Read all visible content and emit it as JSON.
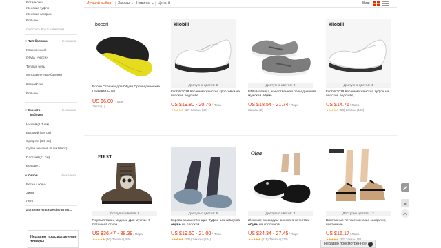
{
  "sidebar": {
    "top_items": [
      "Ботильоны",
      "Женские туфли",
      "Женские сандали",
      "Больше"
    ],
    "more_link": "Смотреть все 5 категорий",
    "shoe_type": {
      "title": "Тип ботинка",
      "reset": "Несколько",
      "items": [
        "Классический",
        "Обувь «челси»",
        "Теплые боты",
        "Мотоциклетные ботинки",
        "Ковбойский",
        "Больше"
      ]
    },
    "heel": {
      "title_line1": "Высота",
      "title_line2": "каблука",
      "reset": "Несколько",
      "items": [
        "Низкий (1-3 см)",
        "Высокий (5-8 см)",
        "Средняя (3-5 см)",
        "Супер высокий (8 см вверх)",
        "Плоский (≤1 см)",
        "Больше"
      ]
    },
    "season": {
      "title": "Сезон",
      "reset": "Несколько",
      "items": [
        "Весна / осень",
        "Зима",
        "Лето"
      ]
    },
    "extra_filters": "Дополнительные фильтры...",
    "recent_title": "Недавно просмотренные товары"
  },
  "toolbar": {
    "best_match": "Лучший выбор",
    "orders": "Заказы",
    "newest": "Новинки",
    "price": "Цена",
    "view_label": "Вид:"
  },
  "products": [
    {
      "brand": "bocori",
      "colors": "",
      "title": "Bocori Стельки для Обуви Ортопедические Подушки Спорт",
      "bold": "",
      "title_rest": "",
      "price": "US $6.00",
      "unit": "/ Пара",
      "rating": "",
      "orders": "Заказ (1)"
    },
    {
      "brand": "kilobili",
      "colors": "Доступно цветов: 2",
      "title": "Kilobili/2018 весенние женские кроссовки на плоской подошве",
      "bold": "",
      "title_rest": "",
      "price": "US $19.80 - 20.76",
      "unit": "/ Пара",
      "rating": "(17)",
      "orders": "Заказы (48)"
    },
    {
      "brand": "",
      "colors": "Доступно цветов: 3",
      "title": "UNN/Новинка, качественная повседневная мужская ",
      "bold": "обувь",
      "title_rest": "",
      "price": "US $18.54 - 21.74",
      "unit": "/ Пара",
      "rating": "",
      "orders": "Заказы (2)"
    },
    {
      "brand": "kilobili",
      "colors": "Доступно цветов: 4",
      "title": "Kilobili/2018 весенние женские туфли на плоской подошве,",
      "bold": "",
      "title_rest": "",
      "price": "US $14.76",
      "unit": "/ Пара",
      "rating": "(53)",
      "orders": "Заказы (132)"
    },
    {
      "brand": "FIRST",
      "colors": "Доступно цветов: 8",
      "title": "Первый танец модные Для мужчин 5 ботинки в стиле",
      "bold": "",
      "title_rest": "",
      "price": "US $36.47 - 38.39",
      "unit": "/ Пара",
      "rating": "(90)",
      "orders": "Заказы (285)"
    },
    {
      "brand": "",
      "colors": "Доступно цветов: 5",
      "title": "Корова замши Женщин Туфли без каблуков ",
      "bold": "обувь",
      "title_rest": " на плоской",
      "price": "US $19.50 - 21.00",
      "unit": "/ Пара",
      "rating": "(105)",
      "orders": "Заказы (184)"
    },
    {
      "brand": "Olga",
      "colors": "Доступно цветов: 3",
      "title": "Женские оксфорды высокого качества ",
      "bold": "обувь",
      "title_rest": " на сплошной",
      "price": "US $24.34 - 27.45",
      "unit": "/ Пара",
      "rating": "(118)",
      "orders": "Заказы (372)"
    },
    {
      "brand": "",
      "colors": "Доступно цветов: 12",
      "title": "Винтажные летние женские сандалии, плетенные",
      "bold": "",
      "title_rest": "",
      "price": "US $16.17",
      "unit": "/ Пара",
      "rating": "(22)",
      "orders": "Заказы (61)"
    }
  ],
  "recent_tab": "Недавно просмотренное",
  "colors": {
    "accent": "#e62e04",
    "active_sort": "#e64700",
    "star": "#f5a623"
  }
}
